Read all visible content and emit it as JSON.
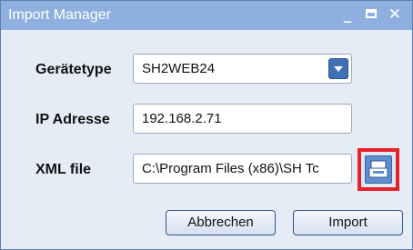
{
  "window": {
    "title": "Import Manager",
    "minimize_glyph": "_",
    "close_glyph": "✕"
  },
  "form": {
    "device_type_label": "Gerätetype",
    "device_type_value": "SH2WEB24",
    "ip_label": "IP Adresse",
    "ip_value": "192.168.2.71",
    "xml_label": "XML file",
    "xml_value": "C:\\Program Files (x86)\\SH Tc"
  },
  "buttons": {
    "cancel_label": "Abbrechen",
    "import_label": "Import"
  },
  "colors": {
    "titlebar": "#8fb0de",
    "highlight": "#e8202a",
    "accent": "#3f6fb5"
  },
  "icons": [
    "minimize-icon",
    "maximize-icon",
    "close-icon",
    "dropdown-arrow-icon",
    "browse-folder-icon"
  ]
}
